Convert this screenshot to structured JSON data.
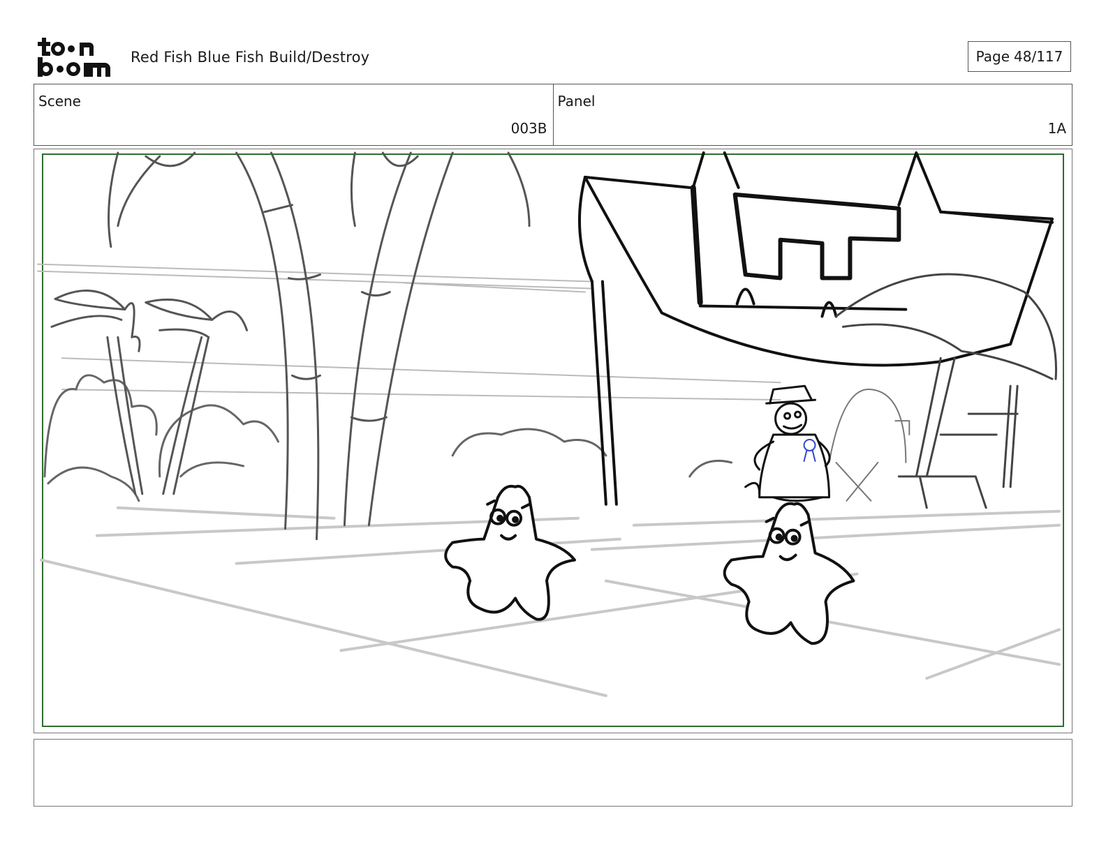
{
  "header": {
    "logo": {
      "icon": "toon-boom-logo",
      "top_text": "toon",
      "bottom_text": "boom"
    },
    "project_title": "Red Fish Blue Fish  Build/Destroy",
    "page_label": "Page",
    "page_value": "48/117"
  },
  "scene": {
    "label": "Scene",
    "value": "003B"
  },
  "panel": {
    "label": "Panel",
    "value": "1A"
  },
  "drawing": {
    "description_icon": "storyboard-sketch",
    "safe_frame_color": "#2e6b2e",
    "accent_color": "#3344cc"
  },
  "notes": {
    "text": ""
  }
}
